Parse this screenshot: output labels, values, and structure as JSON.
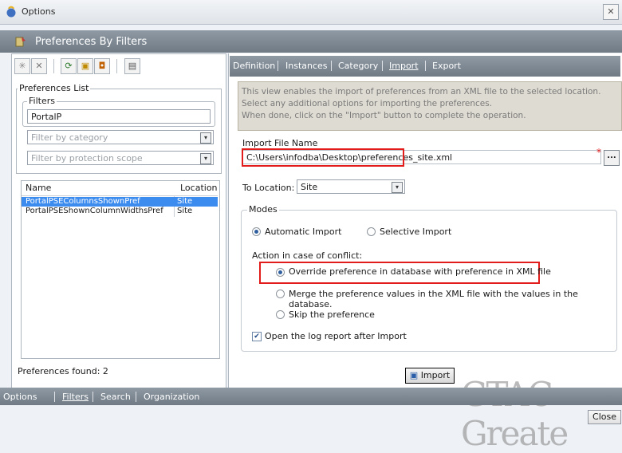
{
  "window": {
    "title": "Options",
    "close_glyph": "✕"
  },
  "header": {
    "title": "Preferences By Filters"
  },
  "left": {
    "toolbar_icons": [
      "asterisk-icon",
      "delete-icon",
      "refresh-icon",
      "lock-icon",
      "unlock-icon",
      "document-icon"
    ],
    "list_legend": "Preferences List",
    "filters_legend": "Filters",
    "filter_value": "PortalP",
    "category_placeholder": "Filter by category",
    "scope_placeholder": "Filter by protection scope",
    "table": {
      "columns": [
        "Name",
        "Location"
      ],
      "rows": [
        {
          "name": "PortalPSEColumnsShownPref",
          "location": "Site"
        },
        {
          "name": "PortalPSEShownColumnWidthsPref",
          "location": "Site"
        }
      ]
    },
    "found": "Preferences found: 2"
  },
  "tabs": [
    "Definition",
    "Instances",
    "Category",
    "Import",
    "Export"
  ],
  "active_tab": "Import",
  "description": [
    "This view enables the import of preferences from an XML file to the selected location.",
    "Select any additional options for importing the preferences.",
    "When done, click on the \"Import\" button to complete the operation."
  ],
  "import": {
    "file_label": "Import File Name",
    "file_value": "C:\\Users\\infodba\\Desktop\\preferences_site.xml",
    "required_mark": "*",
    "browse_label": "...",
    "to_location_label": "To Location:",
    "to_location_value": "Site",
    "modes_legend": "Modes",
    "automatic": "Automatic Import",
    "selective": "Selective Import",
    "conflict_label": "Action in case of conflict:",
    "override": "Override preference in database with preference in XML file",
    "merge": "Merge the preference values in the XML file with the values in the database.",
    "skip": "Skip the preference",
    "open_log": "Open the log report after Import",
    "button": "Import"
  },
  "bottom_tabs": [
    "Options",
    "Filters",
    "Search",
    "Organization"
  ],
  "active_bottom_tab": "Filters",
  "close_button": "Close",
  "watermark": "GTAC Greate",
  "colors": {
    "highlight": "#3c8cf0",
    "red_annotation": "#e21b1b",
    "panel_header": "#7b8690"
  }
}
